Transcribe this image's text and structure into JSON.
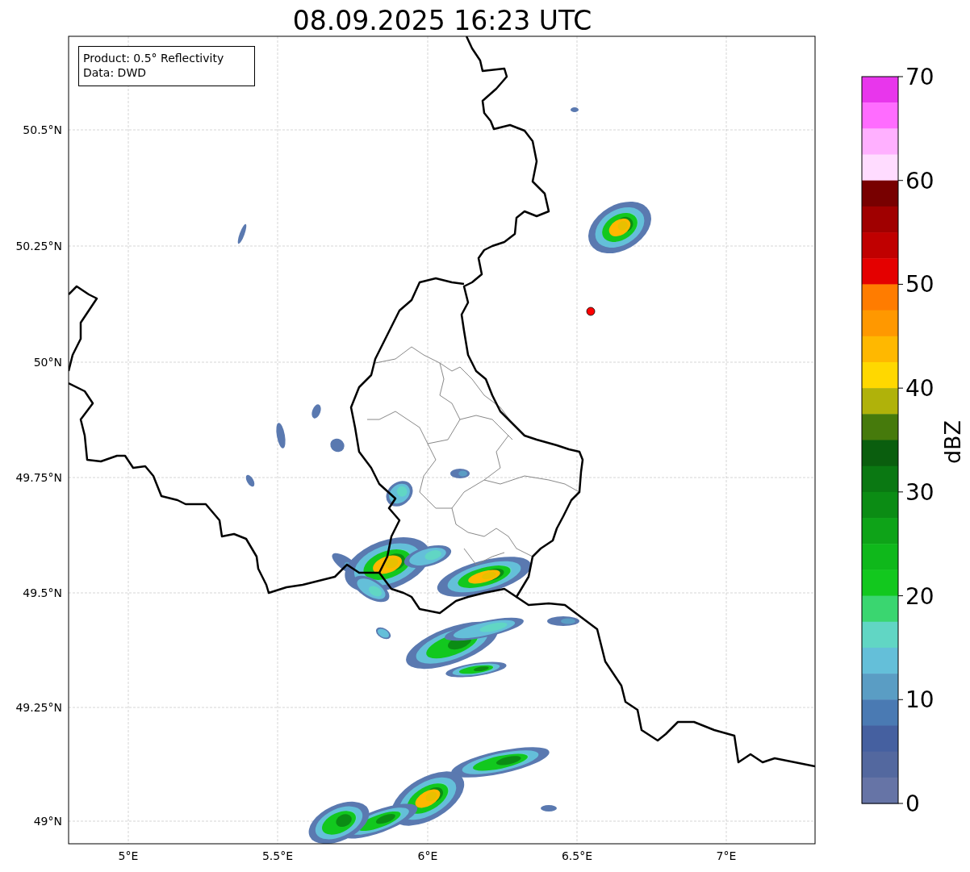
{
  "title": "08.09.2025 16:23 UTC",
  "info_box": [
    "Product: 0.5° Reflectivity",
    "Data: DWD"
  ],
  "map": {
    "y_ticks": [
      "50.5°N",
      "50.25°N",
      "50°N",
      "49.75°N",
      "49.5°N",
      "49.25°N",
      "49°N"
    ],
    "x_ticks": [
      "5°E",
      "5.5°E",
      "6°E",
      "6.5°E",
      "7°E"
    ]
  },
  "colorbar": {
    "label": "dBZ",
    "ticks": [
      "70",
      "60",
      "50",
      "40",
      "30",
      "20",
      "10",
      "0"
    ],
    "segments": [
      {
        "color": "#e836ec"
      },
      {
        "color": "#ff6cff"
      },
      {
        "color": "#ffb0ff"
      },
      {
        "color": "#ffdcff"
      },
      {
        "color": "#780000"
      },
      {
        "color": "#a00000"
      },
      {
        "color": "#c00000"
      },
      {
        "color": "#e40000"
      },
      {
        "color": "#ff7c00"
      },
      {
        "color": "#ff9800"
      },
      {
        "color": "#ffb800"
      },
      {
        "color": "#ffd800"
      },
      {
        "color": "#b0b20a"
      },
      {
        "color": "#467a0c"
      },
      {
        "color": "#0a5e0e"
      },
      {
        "color": "#0a7812"
      },
      {
        "color": "#0b8c14"
      },
      {
        "color": "#0ea318"
      },
      {
        "color": "#0fb81b"
      },
      {
        "color": "#12c81e"
      },
      {
        "color": "#3ad670"
      },
      {
        "color": "#61d6c4"
      },
      {
        "color": "#64bfd9"
      },
      {
        "color": "#5a9dc4"
      },
      {
        "color": "#4a7ab3"
      },
      {
        "color": "#4560a0"
      },
      {
        "color": "#53689f"
      },
      {
        "color": "#6674a6"
      }
    ]
  }
}
